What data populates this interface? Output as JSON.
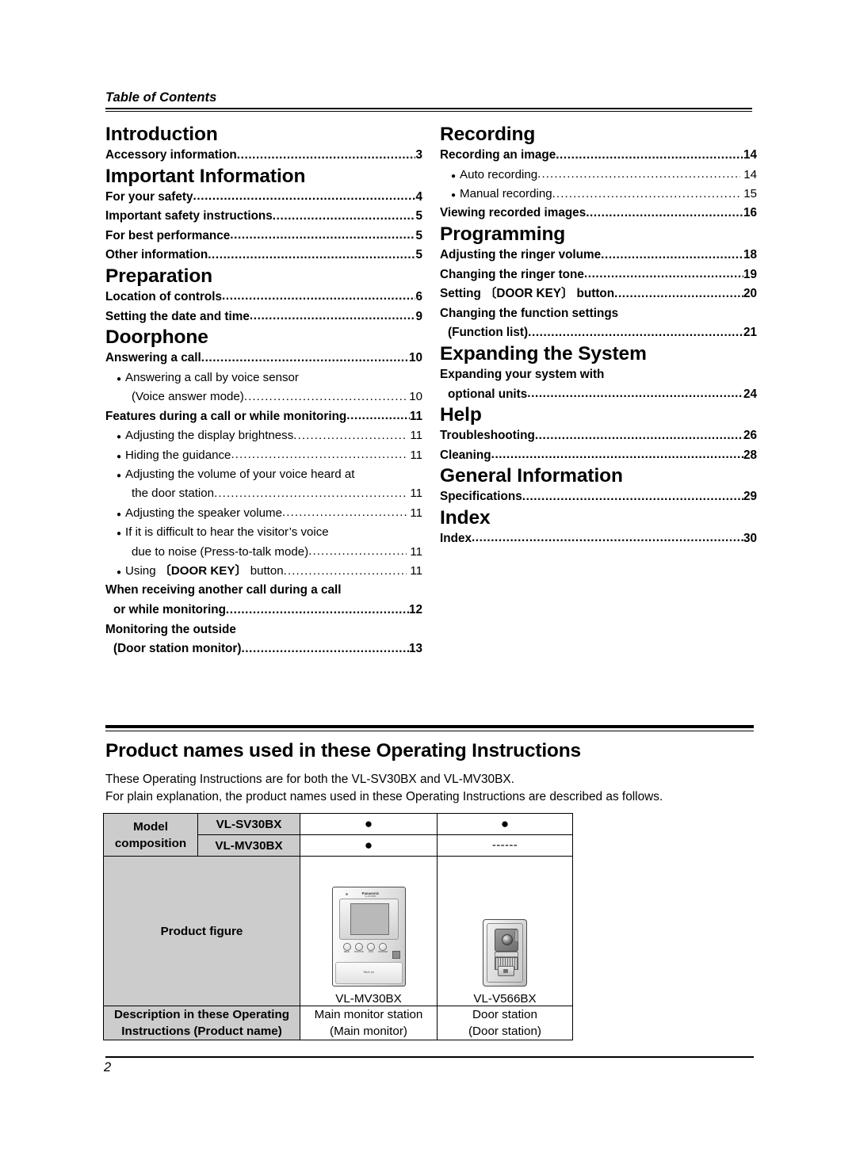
{
  "header": {
    "running_title": "Table of Contents"
  },
  "toc": {
    "left_column": [
      {
        "type": "section",
        "title": "Introduction",
        "entries": [
          {
            "level": 1,
            "label": "Accessory information",
            "page": "3"
          }
        ]
      },
      {
        "type": "section",
        "title": "Important Information",
        "entries": [
          {
            "level": 1,
            "label": "For your safety",
            "page": "4"
          },
          {
            "level": 1,
            "label": "Important safety instructions",
            "page": "5"
          },
          {
            "level": 1,
            "label": "For best performance",
            "page": "5"
          },
          {
            "level": 1,
            "label": "Other information",
            "page": "5"
          }
        ]
      },
      {
        "type": "section",
        "title": "Preparation",
        "entries": [
          {
            "level": 1,
            "label": "Location of controls",
            "page": "6"
          },
          {
            "level": 1,
            "label": "Setting the date and time",
            "page": "9"
          }
        ]
      },
      {
        "type": "section",
        "title": "Doorphone",
        "entries": [
          {
            "level": 1,
            "label": "Answering a call",
            "page": "10"
          },
          {
            "level": 2,
            "bullet": true,
            "label": "Answering a call by voice sensor",
            "cont_label": "(Voice answer mode)",
            "page": "10"
          },
          {
            "level": 1,
            "label": "Features during a call or while monitoring",
            "page": "11"
          },
          {
            "level": 2,
            "bullet": true,
            "label": "Adjusting the display brightness",
            "page": "11"
          },
          {
            "level": 2,
            "bullet": true,
            "label": "Hiding the guidance",
            "page": "11"
          },
          {
            "level": 2,
            "bullet": true,
            "label": "Adjusting the volume of your voice heard at",
            "cont_label": "the door station",
            "page": "11"
          },
          {
            "level": 2,
            "bullet": true,
            "label": "Adjusting the speaker volume",
            "page": "11"
          },
          {
            "level": 2,
            "bullet": true,
            "label": "If it is difficult to hear the visitor’s voice",
            "cont_label": "due to noise (Press-to-talk mode)",
            "page": "11"
          },
          {
            "level": 2,
            "bullet": true,
            "label_pre": "Using ",
            "label_bracket": "〔DOOR KEY〕",
            "label_post": " button",
            "page": "11"
          },
          {
            "level": 1,
            "label": "When receiving another call during a call",
            "cont_label": "or while monitoring",
            "page": "12"
          },
          {
            "level": 1,
            "label": "Monitoring the outside",
            "cont_label": "(Door station monitor)",
            "page": "13"
          }
        ]
      }
    ],
    "right_column": [
      {
        "type": "section",
        "title": "Recording",
        "entries": [
          {
            "level": 1,
            "label": "Recording an image",
            "page": "14"
          },
          {
            "level": 2,
            "bullet": true,
            "label": "Auto recording",
            "page": "14"
          },
          {
            "level": 2,
            "bullet": true,
            "label": "Manual recording",
            "page": "15"
          },
          {
            "level": 1,
            "label": "Viewing recorded images",
            "page": "16"
          }
        ]
      },
      {
        "type": "section",
        "title": "Programming",
        "entries": [
          {
            "level": 1,
            "label": "Adjusting the ringer volume",
            "page": "18"
          },
          {
            "level": 1,
            "label": "Changing the ringer tone",
            "page": "19"
          },
          {
            "level": 1,
            "label_pre": "Setting ",
            "label_bracket": "〔DOOR KEY〕",
            "label_post": " button",
            "page": "20"
          },
          {
            "level": 1,
            "label": "Changing the function settings",
            "cont_label": "(Function list)",
            "page": "21"
          }
        ]
      },
      {
        "type": "section",
        "title": "Expanding the System",
        "entries": [
          {
            "level": 1,
            "label": "Expanding your system with",
            "cont_label": "optional units",
            "page": "24"
          }
        ]
      },
      {
        "type": "section",
        "title": "Help",
        "entries": [
          {
            "level": 1,
            "label": "Troubleshooting",
            "page": "26"
          },
          {
            "level": 1,
            "label": "Cleaning",
            "page": "28"
          }
        ]
      },
      {
        "type": "section",
        "title": "General Information",
        "entries": [
          {
            "level": 1,
            "label": "Specifications",
            "page": "29"
          }
        ]
      },
      {
        "type": "section",
        "title": "Index",
        "entries": [
          {
            "level": 1,
            "label": "Index",
            "page": "30"
          }
        ]
      }
    ]
  },
  "product_names": {
    "heading": "Product names used in these Operating Instructions",
    "paragraph_line1": "These Operating Instructions are for both the VL-SV30BX and VL-MV30BX.",
    "paragraph_line2": "For plain explanation, the product names used in these Operating Instructions are described as follows."
  },
  "product_table": {
    "model_label_line1": "Model",
    "model_label_line2": "composition",
    "row_sv30": {
      "model": "VL-SV30BX",
      "col3": "●",
      "col4": "●"
    },
    "row_mv30": {
      "model": "VL-MV30BX",
      "col3": "●",
      "col4": "------"
    },
    "product_figure_label": "Product figure",
    "figure_caption_monitor": "VL-MV30BX",
    "figure_caption_door": "VL-V566BX",
    "monitor_drawing": {
      "brand": "Panasonic",
      "brand_sub": "VL-MV30BX",
      "talk_label": "TALK on",
      "buttons": [
        "MENU",
        "MONITOR",
        "PLAY\nDEL",
        "DOOR KEY"
      ]
    },
    "desc_label_line1": "Description in these Operating",
    "desc_label_line2": "Instructions (Product name)",
    "desc_monitor_line1": "Main monitor station",
    "desc_monitor_line2": "(Main monitor)",
    "desc_door_line1": "Door station",
    "desc_door_line2": "(Door station)"
  },
  "footer": {
    "page_number": "2"
  }
}
